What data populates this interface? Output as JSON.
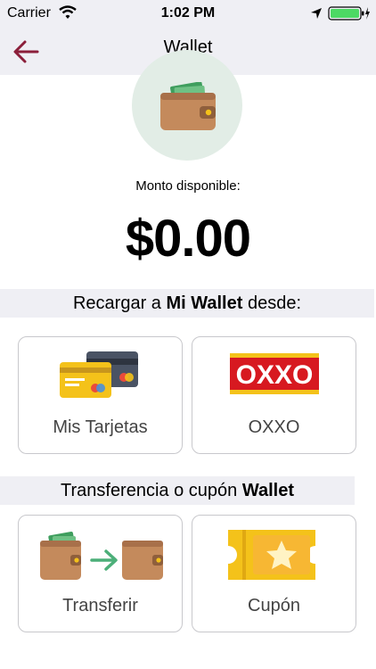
{
  "status_bar": {
    "carrier": "Carrier",
    "time": "1:02 PM"
  },
  "nav": {
    "title": "Wallet"
  },
  "balance": {
    "label": "Monto disponible:",
    "amount": "$0.00"
  },
  "section_recharge": {
    "prefix": "Recargar a ",
    "bold": "Mi Wallet",
    "suffix": " desde:"
  },
  "section_transfer": {
    "prefix": "Transferencia o cupón ",
    "bold": "Wallet"
  },
  "options": {
    "cards": "Mis Tarjetas",
    "oxxo": "OXXO",
    "oxxo_logo": "OXXO",
    "transfer": "Transferir",
    "coupon": "Cupón"
  },
  "colors": {
    "accent": "#8b1f3a",
    "oxxo_red": "#d71920",
    "oxxo_yellow": "#f4c21a",
    "wallet_brown": "#c48a5c",
    "battery_green": "#4cd964"
  }
}
